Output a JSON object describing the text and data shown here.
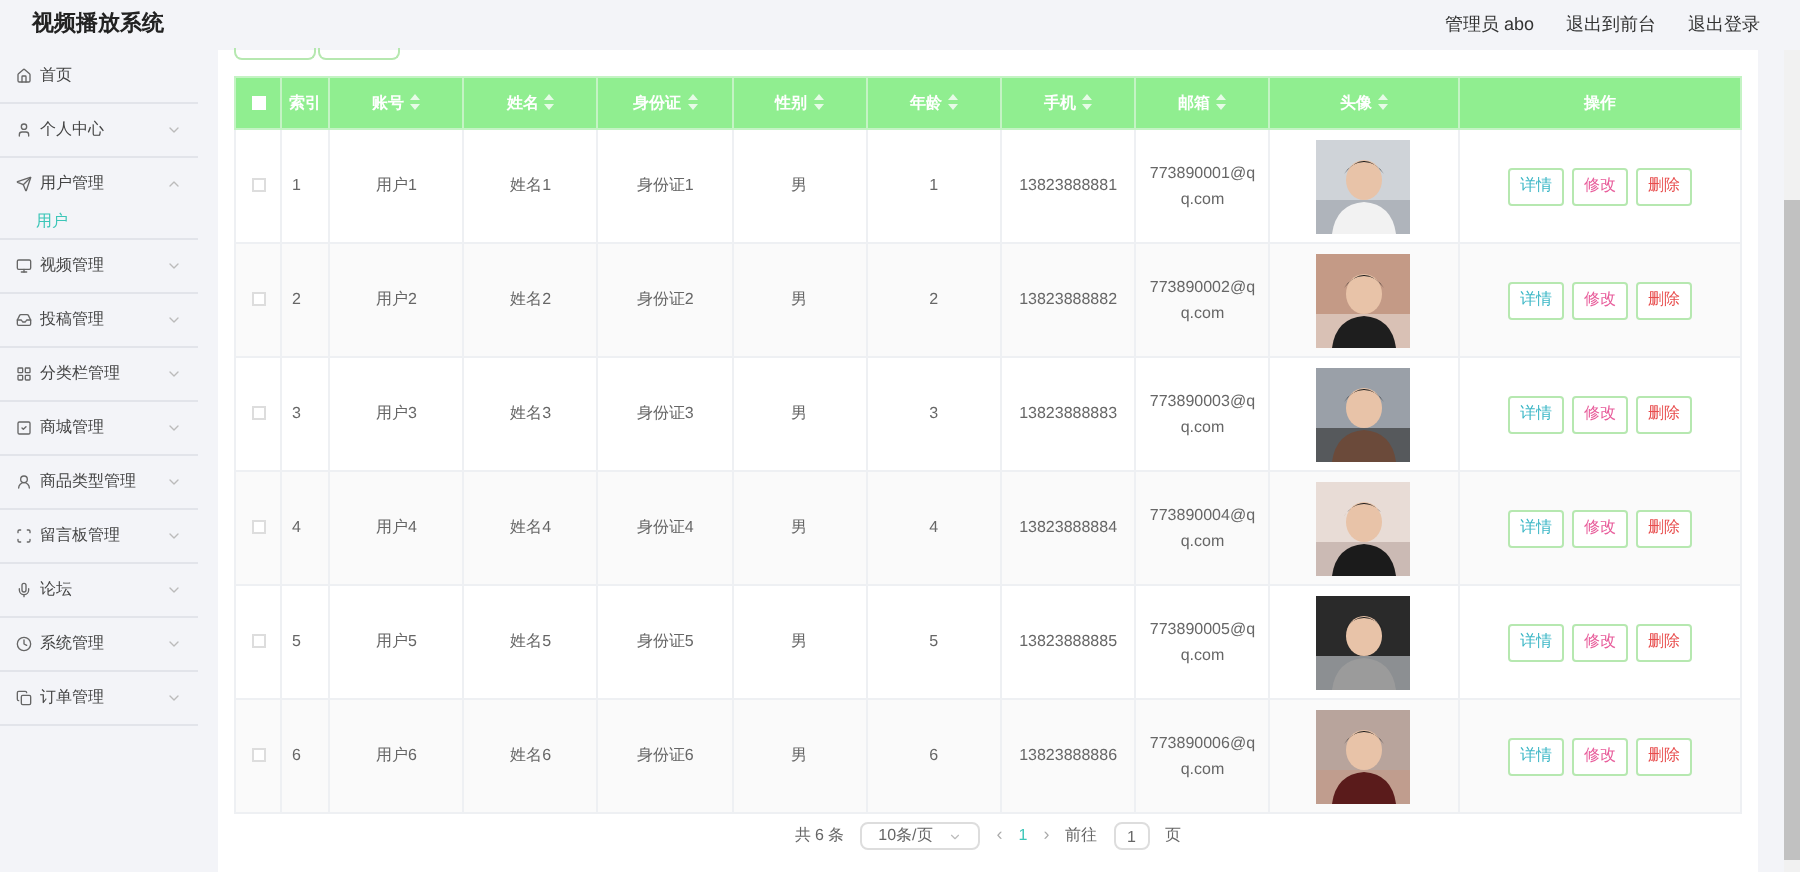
{
  "app_title": "视频播放系统",
  "header_links": [
    {
      "label": "管理员 abo"
    },
    {
      "label": "退出到前台"
    },
    {
      "label": "退出登录"
    }
  ],
  "sidebar": {
    "items": [
      {
        "label": "首页"
      },
      {
        "label": "个人中心",
        "expanded": false
      },
      {
        "label": "用户管理",
        "expanded": true,
        "children": [
          {
            "label": "用户",
            "selected": true
          }
        ]
      },
      {
        "label": "视频管理",
        "expanded": false
      },
      {
        "label": "投稿管理",
        "expanded": false
      },
      {
        "label": "分类栏管理",
        "expanded": false
      },
      {
        "label": "商城管理",
        "expanded": false
      },
      {
        "label": "商品类型管理",
        "expanded": false
      },
      {
        "label": "留言板管理",
        "expanded": false
      },
      {
        "label": "论坛",
        "expanded": false
      },
      {
        "label": "系统管理",
        "expanded": false
      },
      {
        "label": "订单管理",
        "expanded": false
      }
    ]
  },
  "table": {
    "columns": [
      {
        "label": "索引",
        "sortable": false
      },
      {
        "label": "账号",
        "sortable": true
      },
      {
        "label": "姓名",
        "sortable": true
      },
      {
        "label": "身份证",
        "sortable": true
      },
      {
        "label": "性别",
        "sortable": true
      },
      {
        "label": "年龄",
        "sortable": true
      },
      {
        "label": "手机",
        "sortable": true
      },
      {
        "label": "邮箱",
        "sortable": true
      },
      {
        "label": "头像",
        "sortable": true
      },
      {
        "label": "操作",
        "sortable": false
      }
    ],
    "all_checked": false,
    "rows": [
      {
        "checked": false,
        "cells": [
          "1",
          "用户1",
          "姓名1",
          "身份证1",
          "男",
          "1",
          "13823888881",
          "773890001@qq.com"
        ],
        "actions": [
          "详情",
          "修改",
          "删除"
        ]
      },
      {
        "checked": false,
        "cells": [
          "2",
          "用户2",
          "姓名2",
          "身份证2",
          "男",
          "2",
          "13823888882",
          "773890002@qq.com"
        ],
        "actions": [
          "详情",
          "修改",
          "删除"
        ]
      },
      {
        "checked": false,
        "cells": [
          "3",
          "用户3",
          "姓名3",
          "身份证3",
          "男",
          "3",
          "13823888883",
          "773890003@qq.com"
        ],
        "actions": [
          "详情",
          "修改",
          "删除"
        ]
      },
      {
        "checked": false,
        "cells": [
          "4",
          "用户4",
          "姓名4",
          "身份证4",
          "男",
          "4",
          "13823888884",
          "773890004@qq.com"
        ],
        "actions": [
          "详情",
          "修改",
          "删除"
        ]
      },
      {
        "checked": false,
        "cells": [
          "5",
          "用户5",
          "姓名5",
          "身份证5",
          "男",
          "5",
          "13823888885",
          "773890005@qq.com"
        ],
        "actions": [
          "详情",
          "修改",
          "删除"
        ]
      },
      {
        "checked": false,
        "cells": [
          "6",
          "用户6",
          "姓名6",
          "身份证6",
          "男",
          "6",
          "13823888886",
          "773890006@qq.com"
        ],
        "actions": [
          "详情",
          "修改",
          "删除"
        ]
      }
    ]
  },
  "pagination": {
    "total": "共 6 条",
    "page_size": "10条/页",
    "prev": "‹",
    "pages": [
      {
        "label": "1",
        "selected": true
      }
    ],
    "next": "›",
    "goto_label": "前往",
    "goto_value": "1",
    "goto_suffix": "页"
  }
}
